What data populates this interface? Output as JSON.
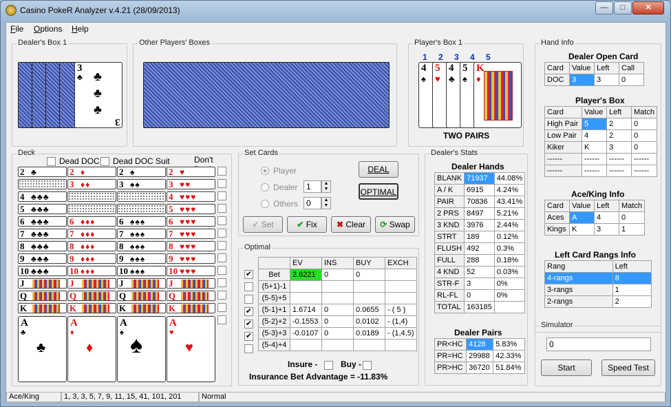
{
  "window": {
    "title": "Casino PokeR Analyzer v.4.21 (28/09/2013)",
    "minimize": "—",
    "maximize": "□",
    "close": "✕"
  },
  "menu": [
    {
      "label": "File",
      "key": "F",
      "rest": "ile"
    },
    {
      "label": "Options",
      "key": "O",
      "rest": "ptions"
    },
    {
      "label": "Help",
      "key": "H",
      "rest": "elp"
    }
  ],
  "dealers_box": {
    "title": "Dealer's Box 1",
    "open_card": {
      "rank": "3",
      "suit": "♣"
    }
  },
  "other_players": {
    "title": "Other Players' Boxes"
  },
  "players_box": {
    "title": "Player's Box 1",
    "positions": [
      "1",
      "2",
      "3",
      "4",
      "5"
    ],
    "cards": [
      {
        "rank": "4",
        "suit": "♠",
        "red": false
      },
      {
        "rank": "5",
        "suit": "♥",
        "red": true
      },
      {
        "rank": "4",
        "suit": "♣",
        "red": false
      },
      {
        "rank": "5",
        "suit": "♠",
        "red": false
      },
      {
        "rank": "K",
        "suit": "♦",
        "red": true
      }
    ],
    "hand": "TWO PAIRS"
  },
  "deck": {
    "title": "Deck",
    "dead_doc": "Dead DOC",
    "dead_doc_suit": "Dead DOC Suit",
    "dont_deal": "Don't Deal",
    "rows": [
      [
        {
          "r": "2",
          "s": "♣"
        },
        {
          "r": "2",
          "s": "♦"
        },
        {
          "r": "2",
          "s": "♠"
        },
        {
          "r": "2",
          "s": "♥"
        }
      ],
      [
        null,
        {
          "r": "3",
          "s": "♦"
        },
        {
          "r": "3",
          "s": "♠"
        },
        {
          "r": "3",
          "s": "♥"
        }
      ],
      [
        {
          "r": "4",
          "s": "♣"
        },
        null,
        null,
        {
          "r": "4",
          "s": "♥"
        }
      ],
      [
        {
          "r": "5",
          "s": "♣"
        },
        null,
        null,
        {
          "r": "5",
          "s": "♥"
        }
      ],
      [
        {
          "r": "6",
          "s": "♣"
        },
        {
          "r": "6",
          "s": "♦"
        },
        {
          "r": "6",
          "s": "♠"
        },
        {
          "r": "6",
          "s": "♥"
        }
      ],
      [
        {
          "r": "7",
          "s": "♣"
        },
        {
          "r": "7",
          "s": "♦"
        },
        {
          "r": "7",
          "s": "♠"
        },
        {
          "r": "7",
          "s": "♥"
        }
      ],
      [
        {
          "r": "8",
          "s": "♣"
        },
        {
          "r": "8",
          "s": "♦"
        },
        {
          "r": "8",
          "s": "♠"
        },
        {
          "r": "8",
          "s": "♥"
        }
      ],
      [
        {
          "r": "9",
          "s": "♣"
        },
        {
          "r": "9",
          "s": "♦"
        },
        {
          "r": "9",
          "s": "♠"
        },
        {
          "r": "9",
          "s": "♥"
        }
      ],
      [
        {
          "r": "10",
          "s": "♣"
        },
        {
          "r": "10",
          "s": "♦"
        },
        {
          "r": "10",
          "s": "♠"
        },
        {
          "r": "10",
          "s": "♥"
        }
      ],
      [
        {
          "r": "J",
          "s": ""
        },
        {
          "r": "J",
          "s": ""
        },
        {
          "r": "J",
          "s": ""
        },
        {
          "r": "J",
          "s": ""
        }
      ],
      [
        {
          "r": "Q",
          "s": ""
        },
        {
          "r": "Q",
          "s": ""
        },
        {
          "r": "Q",
          "s": ""
        },
        {
          "r": "Q",
          "s": ""
        }
      ],
      [
        {
          "r": "K",
          "s": ""
        },
        {
          "r": "K",
          "s": ""
        },
        {
          "r": "K",
          "s": ""
        },
        {
          "r": "K",
          "s": ""
        }
      ]
    ],
    "aces": [
      {
        "r": "A",
        "s": "♣"
      },
      {
        "r": "A",
        "s": "♦"
      },
      {
        "r": "A",
        "s": "♠"
      },
      {
        "r": "A",
        "s": "♥"
      }
    ]
  },
  "set_cards": {
    "title": "Set Cards",
    "player": "Player",
    "dealer": "Dealer",
    "others": "Others",
    "dealer_val": "1",
    "others_val": "0",
    "deal": "DEAL",
    "optimal": "OPTIMAL",
    "set": "Set",
    "fix": "Fix",
    "clear": "Clear",
    "swap": "Swap"
  },
  "optimal": {
    "title": "Optimal",
    "headers": [
      "",
      "EV",
      "INS",
      "BUY",
      "EXCH"
    ],
    "rows": [
      {
        "checked": true,
        "label": "Bet",
        "ev": "2.6221",
        "ins": "0",
        "buy": "0",
        "exch": ""
      },
      {
        "checked": false,
        "label": "(5+1)-1",
        "ev": "",
        "ins": "",
        "buy": "",
        "exch": ""
      },
      {
        "checked": false,
        "label": "(5-5)+5",
        "ev": "",
        "ins": "",
        "buy": "",
        "exch": ""
      },
      {
        "checked": true,
        "label": "(5-1)+1",
        "ev": "1.6714",
        "ins": "0",
        "buy": "0.0655",
        "exch": "- ( 5 )"
      },
      {
        "checked": true,
        "label": "(5-2)+2",
        "ev": "-0.1553",
        "ins": "0",
        "buy": "0.0102",
        "exch": "- (1,4)"
      },
      {
        "checked": true,
        "label": "(5-3)+3",
        "ev": "-0.0107",
        "ins": "0",
        "buy": "0.0189",
        "exch": "- (1,4,5)"
      },
      {
        "checked": false,
        "label": "(5-4)+4",
        "ev": "",
        "ins": "",
        "buy": "",
        "exch": ""
      }
    ],
    "insure": "Insure -",
    "buy": "Buy -",
    "advantage": "Insurance Bet Advantage = -11.83%"
  },
  "dealer_stats": {
    "title": "Dealer's Stats",
    "hands_title": "Dealer Hands",
    "hands": [
      [
        "BLANK",
        "71937",
        "44.08%"
      ],
      [
        "A / K",
        "6915",
        "4.24%"
      ],
      [
        "PAIR",
        "70836",
        "43.41%"
      ],
      [
        "2 PRS",
        "8497",
        "5.21%"
      ],
      [
        "3 KND",
        "3976",
        "2.44%"
      ],
      [
        "STRT",
        "189",
        "0.12%"
      ],
      [
        "FLUSH",
        "492",
        "0.3%"
      ],
      [
        "FULL",
        "288",
        "0.18%"
      ],
      [
        "4 KND",
        "52",
        "0.03%"
      ],
      [
        "STR-F",
        "3",
        "0%"
      ],
      [
        "RL-FL",
        "0",
        "0%"
      ],
      [
        "TOTAL",
        "163185",
        ""
      ]
    ],
    "pairs_title": "Dealer Pairs",
    "pairs": [
      [
        "PR<HC",
        "4128",
        "5.83%"
      ],
      [
        "PR=HC",
        "29988",
        "42.33%"
      ],
      [
        "PR>HC",
        "36720",
        "51.84%"
      ]
    ]
  },
  "hand_info": {
    "title": "Hand Info",
    "doc_title": "Dealer Open Card",
    "doc_headers": [
      "Card",
      "Value",
      "Left",
      "Call"
    ],
    "doc_row": [
      "DOC",
      "3",
      "3",
      "0"
    ],
    "pb_title": "Player's Box",
    "pb_headers": [
      "Card",
      "Value",
      "Left",
      "Match"
    ],
    "pb_rows": [
      [
        "High Pair",
        "5",
        "2",
        "0"
      ],
      [
        "Low Pair",
        "4",
        "2",
        "0"
      ],
      [
        "Kiker",
        "K",
        "3",
        "0"
      ],
      [
        "------",
        "------",
        "------",
        "------"
      ],
      [
        "------",
        "------",
        "------",
        "------"
      ]
    ],
    "ak_title": "Ace/King Info",
    "ak_headers": [
      "Card",
      "Value",
      "Left",
      "Match"
    ],
    "ak_rows": [
      [
        "Aces",
        "A",
        "4",
        "0"
      ],
      [
        "Kings",
        "K",
        "3",
        "1"
      ]
    ],
    "lc_title": "Left Card Rangs Info",
    "lc_headers": [
      "Rang",
      "Left"
    ],
    "lc_rows": [
      [
        "4-rangs",
        "8"
      ],
      [
        "3-rangs",
        "1"
      ],
      [
        "2-rangs",
        "2"
      ]
    ]
  },
  "simulator": {
    "title": "Simulator",
    "value": "0",
    "start": "Start",
    "speed_test": "Speed Test"
  },
  "status": {
    "mode": "Ace/King",
    "sequence": "1, 3, 3, 5, 7, 9, 11, 15, 41, 101, 201",
    "speed": "Normal"
  }
}
